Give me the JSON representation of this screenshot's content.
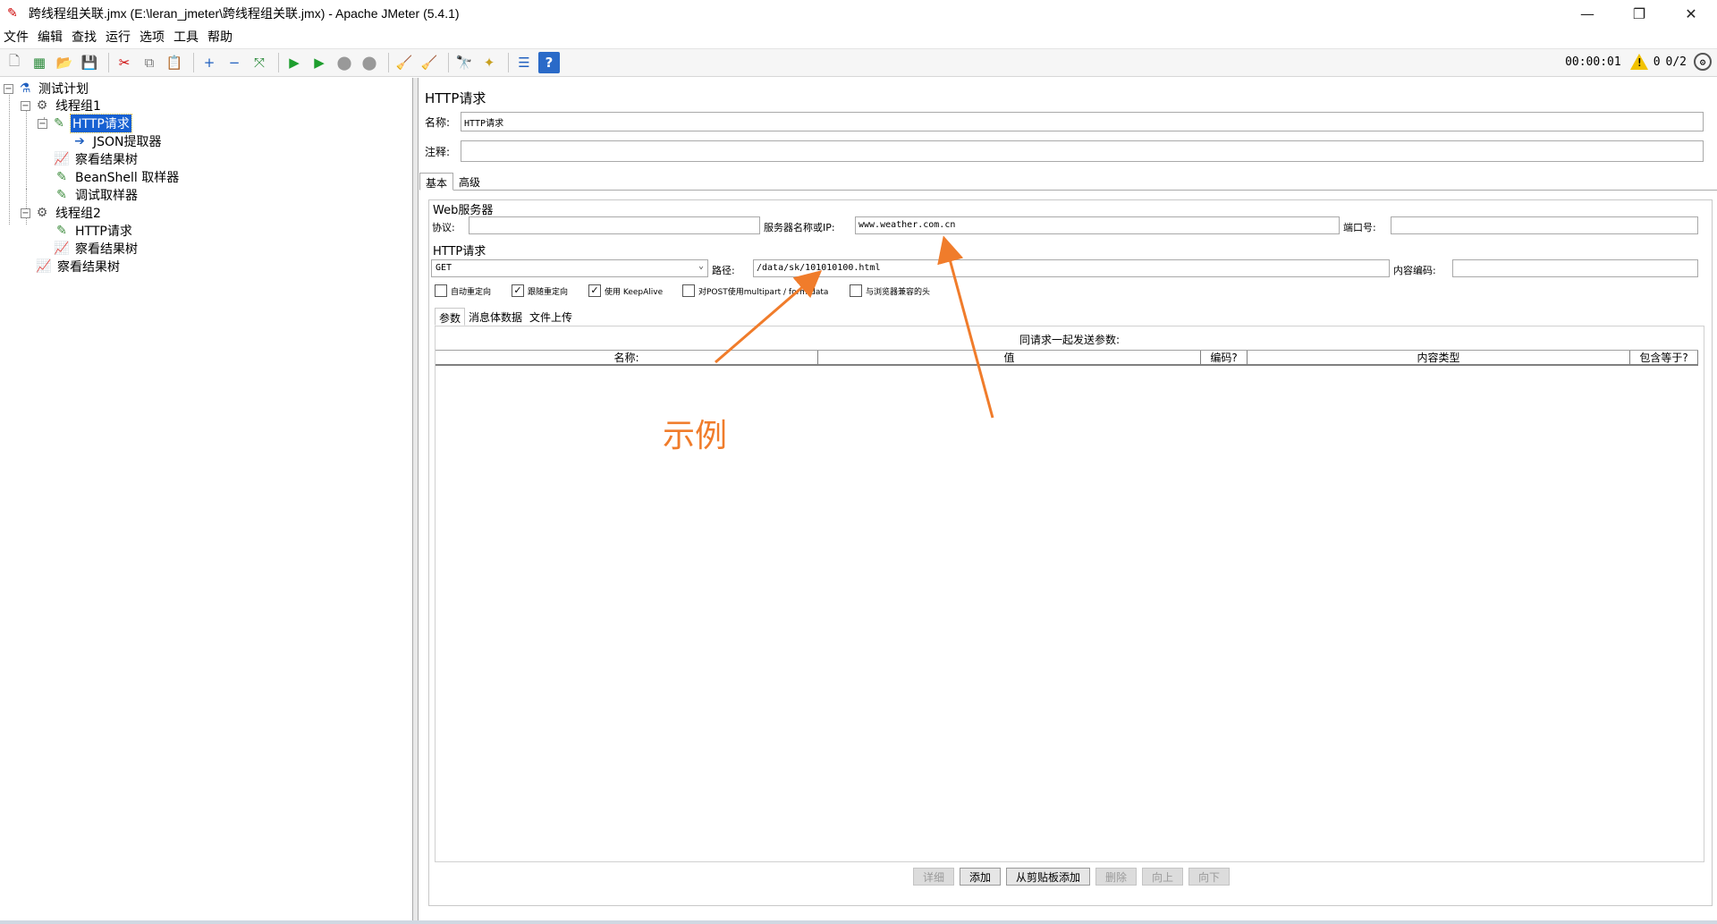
{
  "window": {
    "title": "跨线程组关联.jmx (E:\\leran_jmeter\\跨线程组关联.jmx) - Apache JMeter (5.4.1)",
    "minimize": "—",
    "maximize": "❐",
    "close": "✕"
  },
  "menu": [
    "文件",
    "编辑",
    "查找",
    "运行",
    "选项",
    "工具",
    "帮助"
  ],
  "toolbar": {
    "elapsed_time": "00:00:01",
    "warning_count": "0",
    "threads": "0/2"
  },
  "tree": {
    "test_plan": "测试计划",
    "thread_group_1": "线程组1",
    "http_request_1": "HTTP请求",
    "json_extractor": "JSON提取器",
    "view_results_1": "察看结果树",
    "beanshell": "BeanShell 取样器",
    "debug_sampler": "调试取样器",
    "thread_group_2": "线程组2",
    "http_request_2": "HTTP请求",
    "view_results_2": "察看结果树",
    "view_results_3": "察看结果树"
  },
  "panel": {
    "title": "HTTP请求",
    "name_label": "名称:",
    "name_value": "HTTP请求",
    "comment_label": "注释:",
    "comment_value": "",
    "tabs": [
      "基本",
      "高级"
    ],
    "web_server_title": "Web服务器",
    "protocol_label": "协议:",
    "protocol_value": "",
    "server_label": "服务器名称或IP:",
    "server_value": "www.weather.com.cn",
    "port_label": "端口号:",
    "port_value": "",
    "http_request_title": "HTTP请求",
    "method": "GET",
    "path_label": "路径:",
    "path_value": "/data/sk/101010100.html",
    "encoding_label": "内容编码:",
    "encoding_value": "",
    "checkboxes": {
      "auto_redirect": "自动重定向",
      "follow_redirect": "跟随重定向",
      "keepalive": "使用 KeepAlive",
      "multipart": "对POST使用multipart / form-data",
      "browser_headers": "与浏览器兼容的头"
    },
    "subtabs": [
      "参数",
      "消息体数据",
      "文件上传"
    ],
    "params_caption": "同请求一起发送参数:",
    "columns": [
      "名称:",
      "值",
      "编码?",
      "内容类型",
      "包含等于?"
    ],
    "buttons": {
      "detail": "详细",
      "add": "添加",
      "add_clipboard": "从剪贴板添加",
      "delete": "删除",
      "up": "向上",
      "down": "向下"
    }
  },
  "annotation": {
    "label": "示例",
    "color": "#f07c2b"
  },
  "colors": {
    "selection": "#1660d2"
  }
}
